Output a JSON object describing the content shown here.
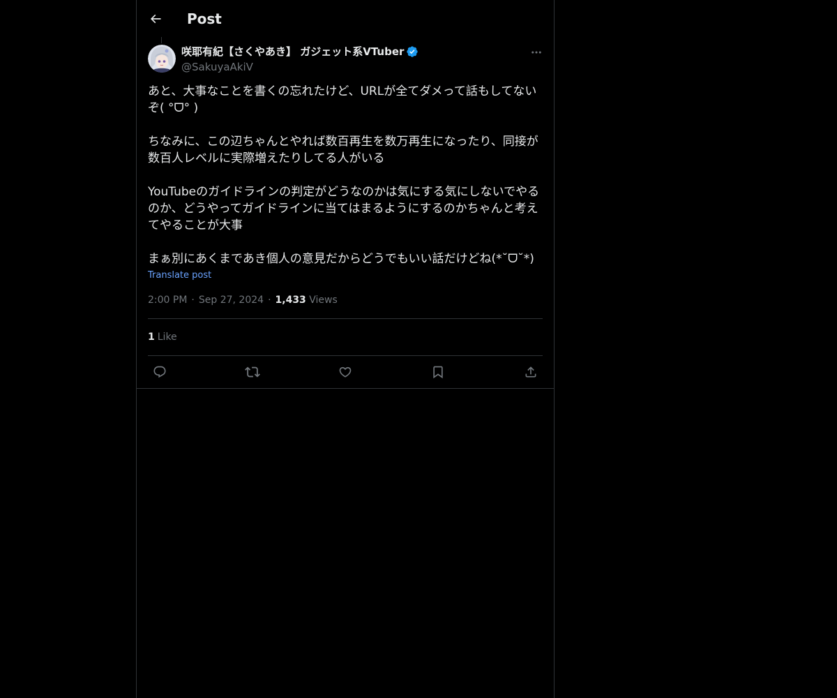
{
  "header": {
    "title": "Post",
    "back_icon": "arrow-left-icon"
  },
  "author": {
    "display_name": "咲耶有紀【さくやあき】 ガジェット系VTuber",
    "handle": "@SakuyaAkiV",
    "verified": true,
    "verified_color": "#1d9bf0"
  },
  "post": {
    "paragraphs": [
      "あと、大事なことを書くの忘れたけど、URLが全てダメって話もしてないぞ( °ᗜ° )",
      "ちなみに、この辺ちゃんとやれば数百再生を数万再生になったり、同接が数百人レベルに実際増えたりしてる人がいる",
      "YouTubeのガイドラインの判定がどうなのかは気にする気にしないでやるのか、どうやってガイドラインに当てはまるようにするのかちゃんと考えてやることが大事",
      "まぁ別にあくまであき個人の意見だからどうでもいい話だけどね(*˘ᗜ˘*)"
    ],
    "translate_label": "Translate post",
    "time": "2:00 PM",
    "date": "Sep 27, 2024",
    "separator": "·",
    "views_count": "1,433",
    "views_label": "Views",
    "likes_count": "1",
    "likes_label": "Like"
  },
  "actions": {
    "reply_icon": "reply-icon",
    "repost_icon": "repost-icon",
    "like_icon": "heart-icon",
    "bookmark_icon": "bookmark-icon",
    "share_icon": "share-icon"
  },
  "colors": {
    "background": "#000000",
    "text": "#e7e9ea",
    "muted": "#71767b",
    "link": "#6aa3ff",
    "border": "#2f3336"
  }
}
